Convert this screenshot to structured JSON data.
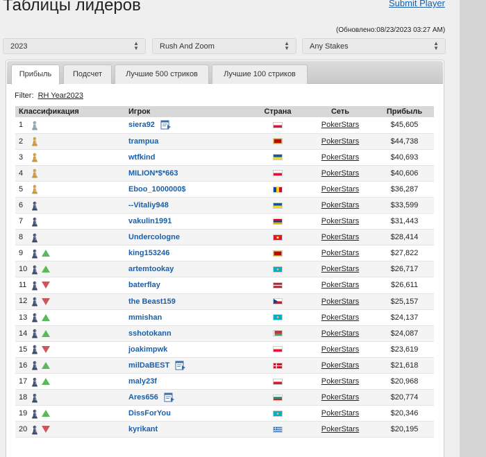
{
  "page": {
    "title": "Таблицы лидеров",
    "submit_link": "Submit Player",
    "updated": "(Обновлено:08/23/2023 03:27 AM)"
  },
  "filters": {
    "year": "2023",
    "game": "Rush And Zoom",
    "stakes": "Any Stakes"
  },
  "tabs": [
    {
      "label": "Прибыль"
    },
    {
      "label": "Подсчет"
    },
    {
      "label": "Лучшие 500 стриков"
    },
    {
      "label": "Лучшие 100 стриков"
    }
  ],
  "filter_label": "Filter:",
  "filter_value": "RH Year2023",
  "table": {
    "headers": [
      "Классификация",
      "Игрок",
      "Страна",
      "Сеть",
      "Прибыль"
    ],
    "rows": [
      {
        "rank": "1",
        "pawn": "silver",
        "trend": "none",
        "player": "siera92",
        "doc": true,
        "flag": "pl",
        "network": "PokerStars",
        "profit": "$45,605"
      },
      {
        "rank": "2",
        "pawn": "gold",
        "trend": "none",
        "player": "trampua",
        "doc": false,
        "flag": "me",
        "network": "PokerStars",
        "profit": "$44,738"
      },
      {
        "rank": "3",
        "pawn": "gold",
        "trend": "none",
        "player": "wtfkind",
        "doc": false,
        "flag": "ua",
        "network": "PokerStars",
        "profit": "$40,693"
      },
      {
        "rank": "4",
        "pawn": "gold",
        "trend": "none",
        "player": "MILION*$*663",
        "doc": false,
        "flag": "pl",
        "network": "PokerStars",
        "profit": "$40,606"
      },
      {
        "rank": "5",
        "pawn": "gold",
        "trend": "none",
        "player": "Eboo_1000000$",
        "doc": false,
        "flag": "md",
        "network": "PokerStars",
        "profit": "$36,287"
      },
      {
        "rank": "6",
        "pawn": "navy",
        "trend": "none",
        "player": "--Vitaliy948",
        "doc": false,
        "flag": "ua",
        "network": "PokerStars",
        "profit": "$33,599"
      },
      {
        "rank": "7",
        "pawn": "navy",
        "trend": "none",
        "player": "vakulin1991",
        "doc": false,
        "flag": "am",
        "network": "PokerStars",
        "profit": "$31,443"
      },
      {
        "rank": "8",
        "pawn": "navy",
        "trend": "none",
        "player": "Undercologne",
        "doc": false,
        "flag": "kg",
        "network": "PokerStars",
        "profit": "$28,414"
      },
      {
        "rank": "9",
        "pawn": "navy",
        "trend": "up",
        "player": "king153246",
        "doc": false,
        "flag": "me",
        "network": "PokerStars",
        "profit": "$27,822"
      },
      {
        "rank": "10",
        "pawn": "navy",
        "trend": "up",
        "player": "artemtookay",
        "doc": false,
        "flag": "kz",
        "network": "PokerStars",
        "profit": "$26,717"
      },
      {
        "rank": "11",
        "pawn": "navy",
        "trend": "down",
        "player": "baterflay",
        "doc": false,
        "flag": "lv",
        "network": "PokerStars",
        "profit": "$26,611"
      },
      {
        "rank": "12",
        "pawn": "navy",
        "trend": "down",
        "player": "the Beast159",
        "doc": false,
        "flag": "cz",
        "network": "PokerStars",
        "profit": "$25,157"
      },
      {
        "rank": "13",
        "pawn": "navy",
        "trend": "up",
        "player": "mmishan",
        "doc": false,
        "flag": "kz",
        "network": "PokerStars",
        "profit": "$24,137"
      },
      {
        "rank": "14",
        "pawn": "navy",
        "trend": "up",
        "player": "sshotokann",
        "doc": false,
        "flag": "by",
        "network": "PokerStars",
        "profit": "$24,087"
      },
      {
        "rank": "15",
        "pawn": "navy",
        "trend": "down",
        "player": "joakimpwk",
        "doc": false,
        "flag": "pl",
        "network": "PokerStars",
        "profit": "$23,619"
      },
      {
        "rank": "16",
        "pawn": "navy",
        "trend": "up",
        "player": "milDaBEST",
        "doc": true,
        "flag": "dk",
        "network": "PokerStars",
        "profit": "$21,618"
      },
      {
        "rank": "17",
        "pawn": "navy",
        "trend": "up",
        "player": "maly23f",
        "doc": false,
        "flag": "pl",
        "network": "PokerStars",
        "profit": "$20,968"
      },
      {
        "rank": "18",
        "pawn": "navy",
        "trend": "none",
        "player": "Ares656",
        "doc": true,
        "flag": "bg",
        "network": "PokerStars",
        "profit": "$20,774"
      },
      {
        "rank": "19",
        "pawn": "navy",
        "trend": "up",
        "player": "DissForYou",
        "doc": false,
        "flag": "kz",
        "network": "PokerStars",
        "profit": "$20,346"
      },
      {
        "rank": "20",
        "pawn": "navy",
        "trend": "down",
        "player": "kyrikant",
        "doc": false,
        "flag": "gr",
        "network": "PokerStars",
        "profit": "$20,195"
      }
    ]
  },
  "colors": {
    "link": "#1a5fa8",
    "trend_up": "#5cb85c",
    "trend_down": "#c9575b",
    "pawn_gold": "#c8963c",
    "pawn_silver": "#8aa0aa",
    "pawn_navy": "#3b4a6b"
  }
}
